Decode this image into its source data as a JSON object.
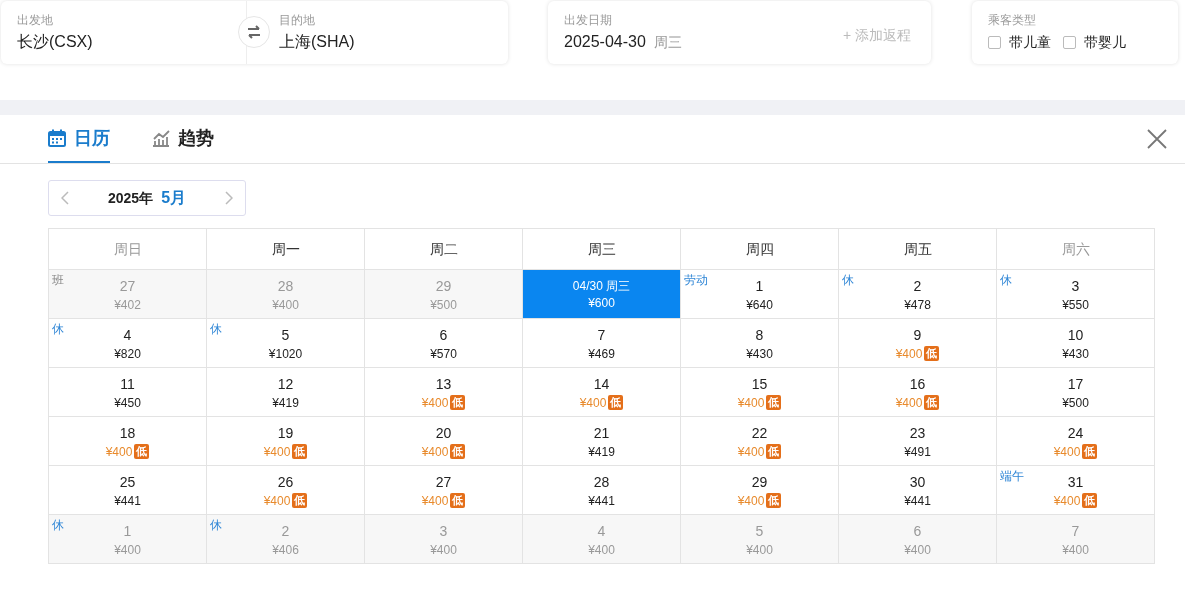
{
  "search": {
    "from": {
      "label": "出发地",
      "value": "长沙(CSX)"
    },
    "to": {
      "label": "目的地",
      "value": "上海(SHA)"
    },
    "date": {
      "label": "出发日期",
      "value": "2025-04-30",
      "weekday": "周三",
      "add_return": "+ 添加返程"
    },
    "passengers": {
      "label": "乘客类型",
      "options": [
        {
          "label": "带儿童",
          "checked": false
        },
        {
          "label": "带婴儿",
          "checked": false
        }
      ]
    }
  },
  "tabs": [
    {
      "label": "日历",
      "kind": "calendar",
      "selected": true
    },
    {
      "label": "趋势",
      "kind": "trend",
      "selected": false
    }
  ],
  "month_picker": {
    "year": "2025年",
    "month": "5月"
  },
  "weekdays": [
    {
      "label": "周日",
      "weekend": true
    },
    {
      "label": "周一",
      "weekend": false
    },
    {
      "label": "周二",
      "weekend": false
    },
    {
      "label": "周三",
      "weekend": false
    },
    {
      "label": "周四",
      "weekend": false
    },
    {
      "label": "周五",
      "weekend": false
    },
    {
      "label": "周六",
      "weekend": true
    }
  ],
  "weeks": [
    [
      {
        "day": "27",
        "price": "¥402",
        "outside": true,
        "selected": false,
        "tag": {
          "text": "班",
          "kind": "workday"
        }
      },
      {
        "day": "28",
        "price": "¥400",
        "outside": true,
        "selected": false
      },
      {
        "day": "29",
        "price": "¥500",
        "outside": true,
        "selected": false
      },
      {
        "day": "04/30 周三",
        "price": "¥600",
        "outside": false,
        "selected": true
      },
      {
        "day": "1",
        "price": "¥640",
        "outside": false,
        "selected": false,
        "tag": {
          "text": "劳动",
          "kind": "holiday"
        }
      },
      {
        "day": "2",
        "price": "¥478",
        "outside": false,
        "selected": false,
        "tag": {
          "text": "休",
          "kind": "holiday"
        }
      },
      {
        "day": "3",
        "price": "¥550",
        "outside": false,
        "selected": false,
        "tag": {
          "text": "休",
          "kind": "holiday"
        }
      }
    ],
    [
      {
        "day": "4",
        "price": "¥820",
        "outside": false,
        "selected": false,
        "tag": {
          "text": "休",
          "kind": "holiday"
        }
      },
      {
        "day": "5",
        "price": "¥1020",
        "outside": false,
        "selected": false,
        "tag": {
          "text": "休",
          "kind": "holiday"
        }
      },
      {
        "day": "6",
        "price": "¥570",
        "outside": false,
        "selected": false
      },
      {
        "day": "7",
        "price": "¥469",
        "outside": false,
        "selected": false
      },
      {
        "day": "8",
        "price": "¥430",
        "outside": false,
        "selected": false
      },
      {
        "day": "9",
        "price": "¥400",
        "badge": "低",
        "outside": false,
        "selected": false
      },
      {
        "day": "10",
        "price": "¥430",
        "outside": false,
        "selected": false
      }
    ],
    [
      {
        "day": "11",
        "price": "¥450",
        "outside": false,
        "selected": false
      },
      {
        "day": "12",
        "price": "¥419",
        "outside": false,
        "selected": false
      },
      {
        "day": "13",
        "price": "¥400",
        "badge": "低",
        "outside": false,
        "selected": false
      },
      {
        "day": "14",
        "price": "¥400",
        "badge": "低",
        "outside": false,
        "selected": false
      },
      {
        "day": "15",
        "price": "¥400",
        "badge": "低",
        "outside": false,
        "selected": false
      },
      {
        "day": "16",
        "price": "¥400",
        "badge": "低",
        "outside": false,
        "selected": false
      },
      {
        "day": "17",
        "price": "¥500",
        "outside": false,
        "selected": false
      }
    ],
    [
      {
        "day": "18",
        "price": "¥400",
        "badge": "低",
        "outside": false,
        "selected": false
      },
      {
        "day": "19",
        "price": "¥400",
        "badge": "低",
        "outside": false,
        "selected": false
      },
      {
        "day": "20",
        "price": "¥400",
        "badge": "低",
        "outside": false,
        "selected": false
      },
      {
        "day": "21",
        "price": "¥419",
        "outside": false,
        "selected": false
      },
      {
        "day": "22",
        "price": "¥400",
        "badge": "低",
        "outside": false,
        "selected": false
      },
      {
        "day": "23",
        "price": "¥491",
        "outside": false,
        "selected": false
      },
      {
        "day": "24",
        "price": "¥400",
        "badge": "低",
        "outside": false,
        "selected": false
      }
    ],
    [
      {
        "day": "25",
        "price": "¥441",
        "outside": false,
        "selected": false
      },
      {
        "day": "26",
        "price": "¥400",
        "badge": "低",
        "outside": false,
        "selected": false
      },
      {
        "day": "27",
        "price": "¥400",
        "badge": "低",
        "outside": false,
        "selected": false
      },
      {
        "day": "28",
        "price": "¥441",
        "outside": false,
        "selected": false
      },
      {
        "day": "29",
        "price": "¥400",
        "badge": "低",
        "outside": false,
        "selected": false
      },
      {
        "day": "30",
        "price": "¥441",
        "outside": false,
        "selected": false
      },
      {
        "day": "31",
        "price": "¥400",
        "badge": "低",
        "outside": false,
        "selected": false,
        "tag": {
          "text": "端午",
          "kind": "holiday"
        }
      }
    ],
    [
      {
        "day": "1",
        "price": "¥400",
        "outside": true,
        "selected": false,
        "tag": {
          "text": "休",
          "kind": "holiday"
        }
      },
      {
        "day": "2",
        "price": "¥406",
        "outside": true,
        "selected": false,
        "tag": {
          "text": "休",
          "kind": "holiday"
        }
      },
      {
        "day": "3",
        "price": "¥400",
        "outside": true,
        "selected": false
      },
      {
        "day": "4",
        "price": "¥400",
        "outside": true,
        "selected": false
      },
      {
        "day": "5",
        "price": "¥400",
        "outside": true,
        "selected": false
      },
      {
        "day": "6",
        "price": "¥400",
        "outside": true,
        "selected": false
      },
      {
        "day": "7",
        "price": "¥400",
        "outside": true,
        "selected": false
      }
    ]
  ]
}
